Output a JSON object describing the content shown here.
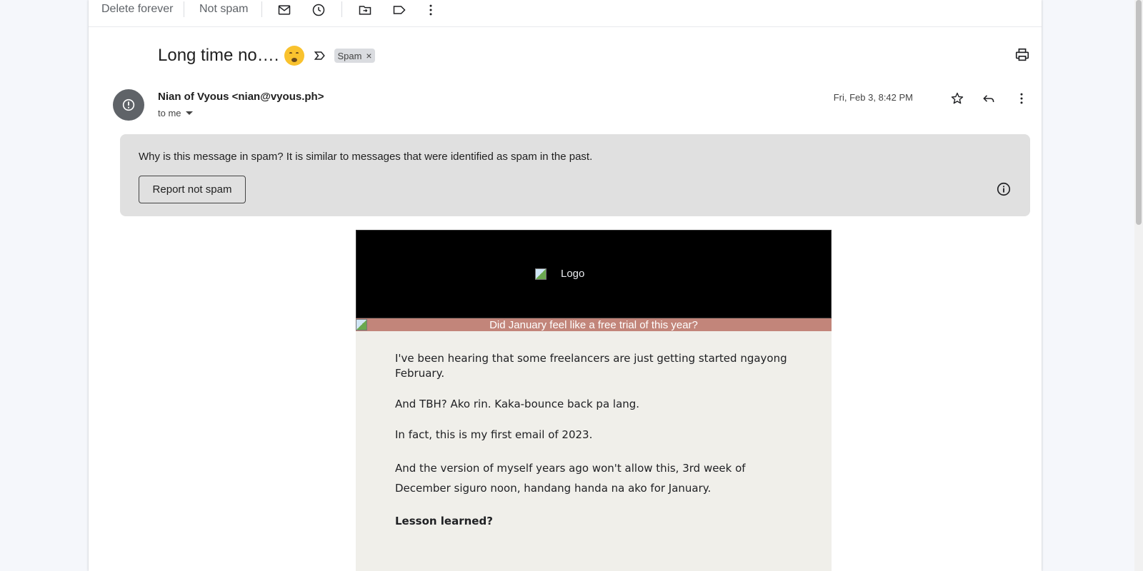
{
  "toolbar": {
    "delete_forever": "Delete forever",
    "not_spam": "Not spam"
  },
  "message": {
    "subject": "Long time no….",
    "label_chip": "Spam",
    "sender": "Nian of Vyous <nian@vyous.ph>",
    "recipient": "to me",
    "date": "Fri, Feb 3, 8:42 PM"
  },
  "spam_banner": {
    "text": "Why is this message in spam? It is similar to messages that were identified as spam in the past.",
    "report_button": "Report not spam"
  },
  "email": {
    "logo_alt": "Logo",
    "strip_text": "Did January feel like a free trial of this year?",
    "paragraphs": [
      "I've been hearing that some freelancers are just getting started ngayong February.",
      "And TBH? Ako rin. Kaka-bounce back pa lang.",
      "In fact, this is my first email of 2023.",
      "And the version of myself years ago won't allow this, 3rd week of December siguro noon, handang handa na ako for January.",
      "Lesson learned?"
    ]
  },
  "icons": {
    "toolbar": [
      "mail-icon",
      "clock-icon",
      "move-to-icon",
      "label-icon",
      "more-vert-icon"
    ],
    "header": [
      "print-icon",
      "star-icon",
      "reply-icon",
      "more-vert-icon"
    ],
    "banner": "info-icon",
    "avatar": "alert-icon"
  }
}
